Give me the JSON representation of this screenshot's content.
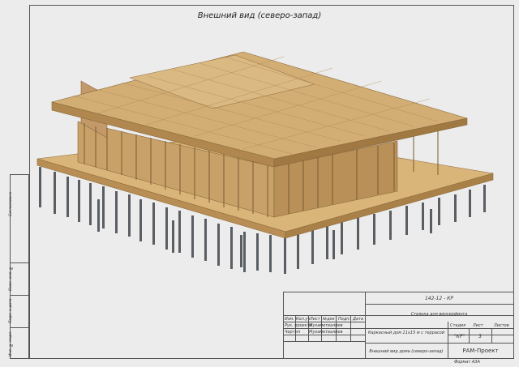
{
  "drawing": {
    "title": "Внешний вид (северо-запад)"
  },
  "side_stamp": {
    "labels": [
      "Согласовано",
      "Взам. инв. №",
      "Подп. и дата",
      "Инв. № подл."
    ]
  },
  "title_block": {
    "code": "142-12 - КР",
    "section_title": "Стоянка для винсерфинга",
    "object_name": "Каркасный дом 11х15 м с террасой",
    "sheet_title": "Внешний вид дома (северо-запад)",
    "org": "РАМ-Проект",
    "header_cols": [
      "Изм.",
      "Кол.уч",
      "Лист",
      "№док",
      "Подп.",
      "Дата"
    ],
    "rows": [
      {
        "role": "Рук. проекта",
        "name": "Мухаметвалиев"
      },
      {
        "role": "Чертил",
        "name": "Мухаметвалиев"
      }
    ],
    "stage_label": "Стадия",
    "sheet_label": "Лист",
    "sheets_label": "Листов",
    "stage_value": "\"КР\"",
    "sheet_value": "3",
    "sheets_value": "",
    "format": "Формат А3А"
  },
  "colors": {
    "background": "#ececec",
    "wood": "#c9a26a",
    "wood_dark": "#9c7a4a",
    "piles": "#5a5e63"
  }
}
